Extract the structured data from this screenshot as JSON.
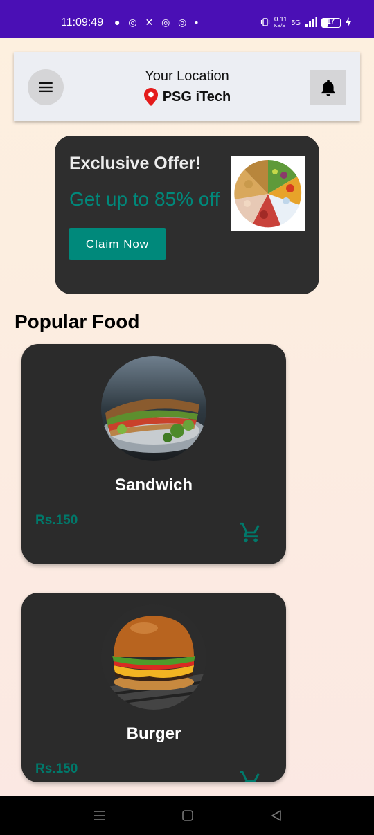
{
  "status_bar": {
    "time": "11:09:49",
    "left_icons": "● ◎ ✕ ◎ ◎ •",
    "data_speed": "0.11",
    "data_unit": "KB/S",
    "network": "5G",
    "battery": "17"
  },
  "header": {
    "location_title": "Your Location",
    "location_name": "PSG iTech",
    "menu_icon": "hamburger-menu-icon",
    "bell_icon": "bell-icon",
    "pin_color": "#e41b1b"
  },
  "offer": {
    "title": "Exclusive Offer!",
    "subtitle": "Get up to 85% off",
    "button_label": "Claim Now",
    "accent_color": "#00897b"
  },
  "popular": {
    "title": "Popular Food",
    "items": [
      {
        "name": "Sandwich",
        "price": "Rs.150"
      },
      {
        "name": "Burger",
        "price": "Rs.150"
      }
    ]
  }
}
